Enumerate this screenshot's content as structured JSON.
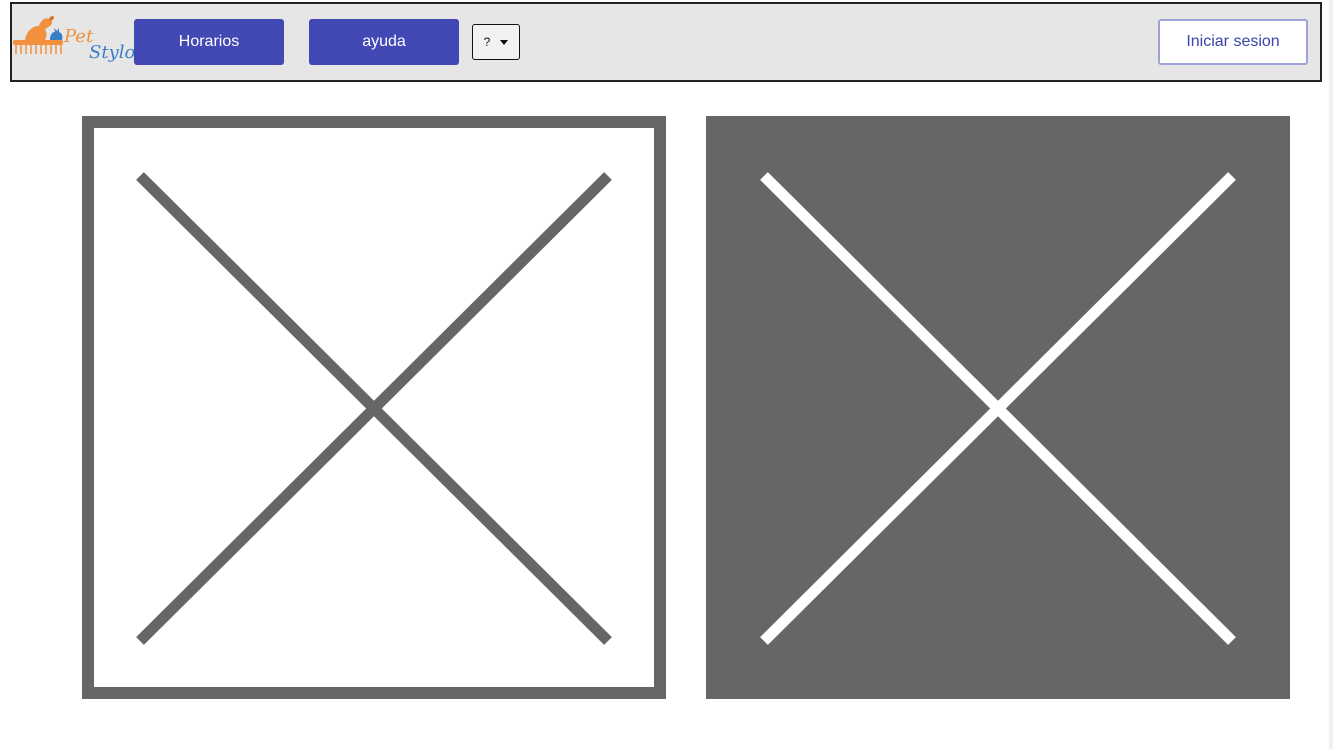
{
  "header": {
    "logo": {
      "word1": "Pet",
      "word2": "Stylo"
    },
    "nav": {
      "horarios_label": "Horarios",
      "ayuda_label": "ayuda"
    },
    "language_select": {
      "selected": "?"
    },
    "login_label": "Iniciar sesion"
  },
  "images": [
    {
      "name": "image-placeholder-left",
      "icon": "broken-image-x",
      "style": "outline",
      "colors": {
        "fill": "#ffffff",
        "stroke": "#666666"
      }
    },
    {
      "name": "image-placeholder-right",
      "icon": "broken-image-x",
      "style": "filled",
      "colors": {
        "fill": "#666666",
        "stroke": "#ffffff"
      }
    }
  ],
  "colors": {
    "navbar_bg": "#e6e6e6",
    "primary_button": "#4248b4",
    "login_text": "#3b44a8",
    "logo_orange": "#f2903e",
    "logo_blue": "#3a7fc6"
  }
}
